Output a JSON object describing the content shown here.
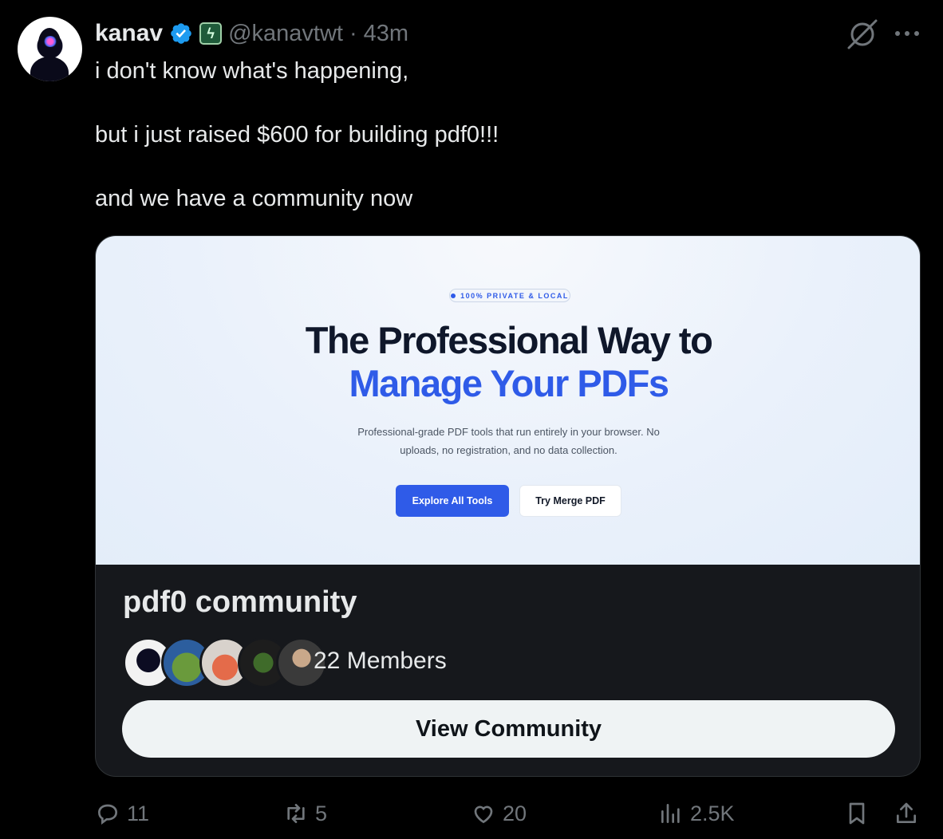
{
  "tweet": {
    "author_name": "kanav",
    "handle": "@kanavtwt",
    "separator": "·",
    "time": "43m",
    "flair_glyph": "ϟ",
    "lines": [
      "i don't know what's happening,",
      "but i just raised $600 for building pdf0!!!",
      "and we have a community now"
    ]
  },
  "card": {
    "preview": {
      "pill": "100% PRIVATE & LOCAL",
      "title_line1": "The Professional Way to",
      "title_line2": "Manage Your PDFs",
      "desc_line1": "Professional-grade PDF tools that run entirely in your browser. No",
      "desc_line2": "uploads, no registration, and no data collection.",
      "primary_button": "Explore All Tools",
      "secondary_button": "Try Merge PDF"
    },
    "community_name": "pdf0 community",
    "members": "22 Members",
    "view_button": "View Community"
  },
  "actions": {
    "replies": "11",
    "reposts": "5",
    "likes": "20",
    "views": "2.5K"
  },
  "colors": {
    "accent": "#1d9bf0",
    "hero_blue": "#2f5be8",
    "muted": "#71767b"
  }
}
